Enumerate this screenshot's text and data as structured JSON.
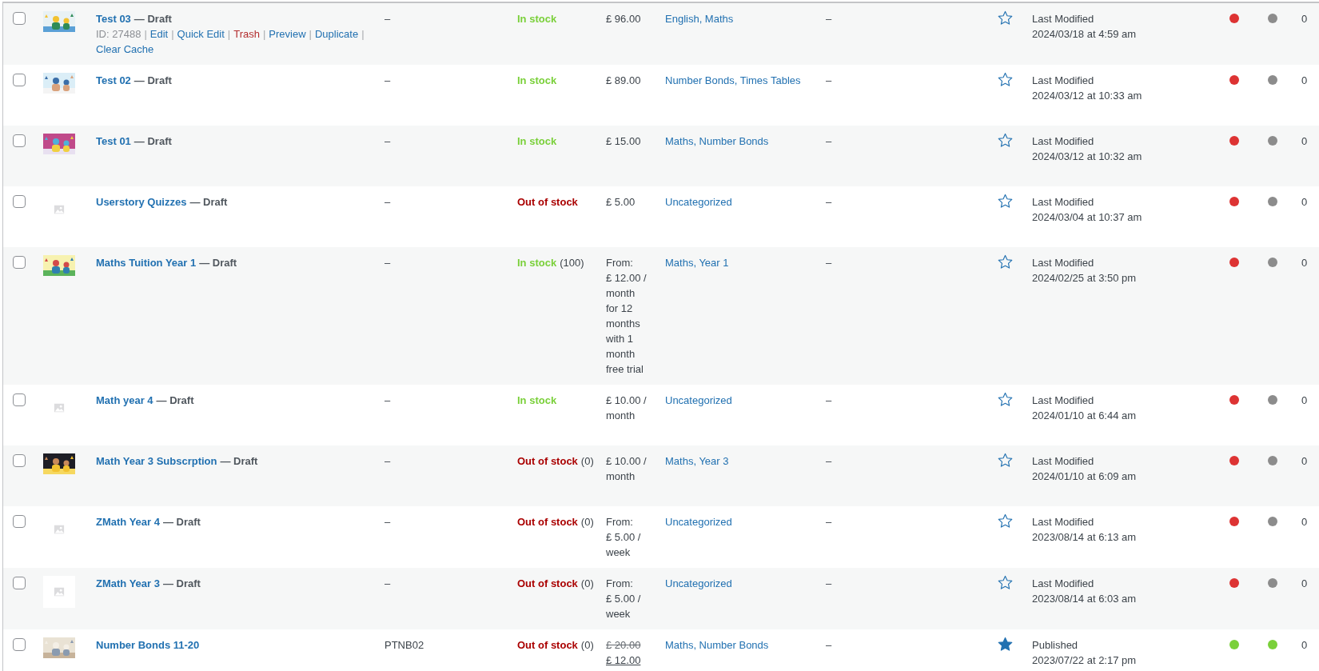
{
  "rows": [
    {
      "checked": false,
      "thumbnail": {
        "kind": "picture"
      },
      "name": "Test 03",
      "status": "— Draft",
      "row_actions": {
        "separator": "|",
        "items": [
          {
            "kind": "meta",
            "label": "ID: 27488"
          },
          {
            "kind": "link",
            "label": "Edit"
          },
          {
            "kind": "link",
            "label": "Quick Edit"
          },
          {
            "kind": "danger",
            "label": "Trash"
          },
          {
            "kind": "link",
            "label": "Preview"
          },
          {
            "kind": "link",
            "label": "Duplicate"
          },
          {
            "kind": "link",
            "label": "Clear Cache"
          }
        ]
      },
      "sku": "–",
      "stock": {
        "kind": "in",
        "label": "In stock"
      },
      "price": [
        {
          "kind": "plain",
          "text": "£ 96.00"
        }
      ],
      "categories": "English, Maths",
      "tags": "–",
      "featured": false,
      "date_label": "Last Modified",
      "date": "2024/03/18 at 4:59 am",
      "dots": [
        {
          "color": "#dd3333"
        },
        {
          "color": "#8c8c8c"
        }
      ],
      "count": "0"
    },
    {
      "checked": false,
      "thumbnail": {
        "kind": "picture"
      },
      "name": "Test 02",
      "status": "— Draft",
      "sku": "–",
      "stock": {
        "kind": "in",
        "label": "In stock"
      },
      "price": [
        {
          "kind": "plain",
          "text": "£ 89.00"
        }
      ],
      "categories": "Number Bonds, Times Tables",
      "tags": "–",
      "featured": false,
      "date_label": "Last Modified",
      "date": "2024/03/12 at 10:33 am",
      "dots": [
        {
          "color": "#dd3333"
        },
        {
          "color": "#8c8c8c"
        }
      ],
      "count": "0"
    },
    {
      "checked": false,
      "thumbnail": {
        "kind": "picture"
      },
      "name": "Test 01",
      "status": "— Draft",
      "sku": "–",
      "stock": {
        "kind": "in",
        "label": "In stock"
      },
      "price": [
        {
          "kind": "plain",
          "text": "£ 15.00"
        }
      ],
      "categories": "Maths, Number Bonds",
      "tags": "–",
      "featured": false,
      "date_label": "Last Modified",
      "date": "2024/03/12 at 10:32 am",
      "dots": [
        {
          "color": "#dd3333"
        },
        {
          "color": "#8c8c8c"
        }
      ],
      "count": "0"
    },
    {
      "checked": false,
      "thumbnail": {
        "kind": "placeholder"
      },
      "name": "Userstory Quizzes",
      "status": "— Draft",
      "sku": "–",
      "stock": {
        "kind": "out",
        "label": "Out of stock"
      },
      "price": [
        {
          "kind": "plain",
          "text": "£ 5.00"
        }
      ],
      "categories": "Uncategorized",
      "tags": "–",
      "featured": false,
      "date_label": "Last Modified",
      "date": "2024/03/04 at 10:37 am",
      "dots": [
        {
          "color": "#dd3333"
        },
        {
          "color": "#8c8c8c"
        }
      ],
      "count": "0"
    },
    {
      "checked": false,
      "thumbnail": {
        "kind": "picture"
      },
      "name": "Maths Tuition Year 1",
      "status": "— Draft",
      "sku": "–",
      "stock": {
        "kind": "in",
        "label": "In stock",
        "count": "(100)"
      },
      "price": [
        {
          "kind": "plain",
          "text": "From:"
        },
        {
          "kind": "plain",
          "text": "£ 12.00 /"
        },
        {
          "kind": "plain",
          "text": "month"
        },
        {
          "kind": "plain",
          "text": "for 12"
        },
        {
          "kind": "plain",
          "text": "months"
        },
        {
          "kind": "plain",
          "text": "with 1"
        },
        {
          "kind": "plain",
          "text": "month"
        },
        {
          "kind": "plain",
          "text": "free trial"
        }
      ],
      "categories": "Maths, Year 1",
      "tags": "–",
      "featured": false,
      "date_label": "Last Modified",
      "date": "2024/02/25 at 3:50 pm",
      "dots": [
        {
          "color": "#dd3333"
        },
        {
          "color": "#8c8c8c"
        }
      ],
      "count": "0"
    },
    {
      "checked": false,
      "thumbnail": {
        "kind": "placeholder"
      },
      "name": "Math year 4",
      "status": "— Draft",
      "sku": "–",
      "stock": {
        "kind": "in",
        "label": "In stock"
      },
      "price": [
        {
          "kind": "plain",
          "text": "£ 10.00 /"
        },
        {
          "kind": "plain",
          "text": "month"
        }
      ],
      "categories": "Uncategorized",
      "tags": "–",
      "featured": false,
      "date_label": "Last Modified",
      "date": "2024/01/10 at 6:44 am",
      "dots": [
        {
          "color": "#dd3333"
        },
        {
          "color": "#8c8c8c"
        }
      ],
      "count": "0"
    },
    {
      "checked": false,
      "thumbnail": {
        "kind": "picture"
      },
      "name": "Math Year 3 Subscrption",
      "status": "— Draft",
      "sku": "–",
      "stock": {
        "kind": "out",
        "label": "Out of stock",
        "count": "(0)"
      },
      "price": [
        {
          "kind": "plain",
          "text": "£ 10.00 /"
        },
        {
          "kind": "plain",
          "text": "month"
        }
      ],
      "categories": "Maths, Year 3",
      "tags": "–",
      "featured": false,
      "date_label": "Last Modified",
      "date": "2024/01/10 at 6:09 am",
      "dots": [
        {
          "color": "#dd3333"
        },
        {
          "color": "#8c8c8c"
        }
      ],
      "count": "0"
    },
    {
      "checked": false,
      "thumbnail": {
        "kind": "placeholder"
      },
      "name": "ZMath Year 4",
      "status": "— Draft",
      "sku": "–",
      "stock": {
        "kind": "out",
        "label": "Out of stock",
        "count": "(0)"
      },
      "price": [
        {
          "kind": "plain",
          "text": "From:"
        },
        {
          "kind": "plain",
          "text": "£ 5.00 /"
        },
        {
          "kind": "plain",
          "text": "week"
        }
      ],
      "categories": "Uncategorized",
      "tags": "–",
      "featured": false,
      "date_label": "Last Modified",
      "date": "2023/08/14 at 6:13 am",
      "dots": [
        {
          "color": "#dd3333"
        },
        {
          "color": "#8c8c8c"
        }
      ],
      "count": "0"
    },
    {
      "checked": false,
      "thumbnail": {
        "kind": "framed"
      },
      "name": "ZMath Year 3",
      "status": "— Draft",
      "sku": "–",
      "stock": {
        "kind": "out",
        "label": "Out of stock",
        "count": "(0)"
      },
      "price": [
        {
          "kind": "plain",
          "text": "From:"
        },
        {
          "kind": "plain",
          "text": "£ 5.00 /"
        },
        {
          "kind": "plain",
          "text": "week"
        }
      ],
      "categories": "Uncategorized",
      "tags": "–",
      "featured": false,
      "date_label": "Last Modified",
      "date": "2023/08/14 at 6:03 am",
      "dots": [
        {
          "color": "#dd3333"
        },
        {
          "color": "#8c8c8c"
        }
      ],
      "count": "0"
    },
    {
      "checked": false,
      "thumbnail": {
        "kind": "picture"
      },
      "name": "Number Bonds 11-20",
      "sku": "PTNB02",
      "stock": {
        "kind": "out",
        "label": "Out of stock",
        "count": "(0)"
      },
      "price": [
        {
          "kind": "old",
          "text": "£ 20.00"
        },
        {
          "kind": "sale",
          "text": "£ 12.00"
        }
      ],
      "categories": "Maths, Number Bonds",
      "tags": "–",
      "featured": true,
      "date_label": "Published",
      "date": "2023/07/22 at 2:17 pm",
      "dots": [
        {
          "color": "#7ad03a"
        },
        {
          "color": "#7ad03a"
        }
      ],
      "count": "0"
    }
  ]
}
